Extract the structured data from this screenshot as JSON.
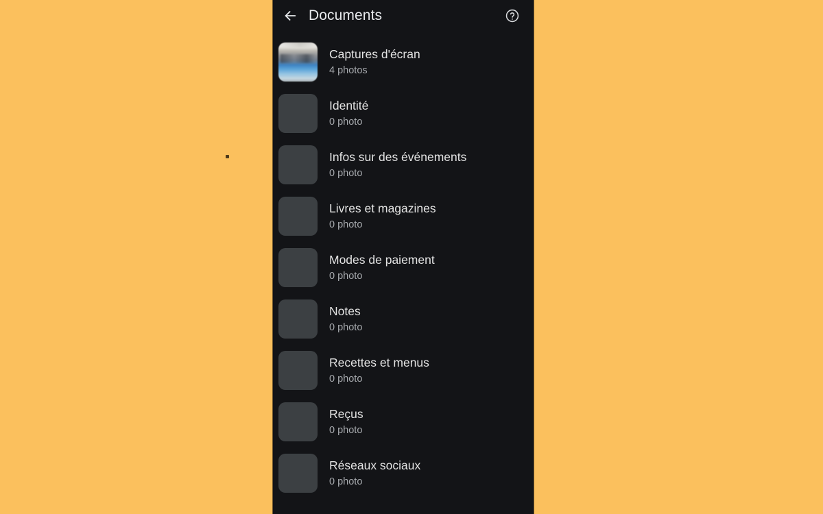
{
  "backdrop": {
    "color": "#fbc05d",
    "speck_color": "#3a2a12"
  },
  "phone": {
    "screen_bg": "#131417"
  },
  "app_bar": {
    "back_icon": "arrow-left-icon",
    "title": "Documents",
    "help_icon": "help-circle-icon",
    "title_color": "#e8eaed"
  },
  "list": {
    "items": [
      {
        "title": "Captures d'écran",
        "count": "4 photos",
        "thumb": "photo-thumbnail"
      },
      {
        "title": "Identité",
        "count": "0 photo",
        "thumb": "placeholder-thumbnail"
      },
      {
        "title": "Infos sur des événements",
        "count": "0 photo",
        "thumb": "placeholder-thumbnail"
      },
      {
        "title": "Livres et magazines",
        "count": "0 photo",
        "thumb": "placeholder-thumbnail"
      },
      {
        "title": "Modes de paiement",
        "count": "0 photo",
        "thumb": "placeholder-thumbnail"
      },
      {
        "title": "Notes",
        "count": "0 photo",
        "thumb": "placeholder-thumbnail"
      },
      {
        "title": "Recettes et menus",
        "count": "0 photo",
        "thumb": "placeholder-thumbnail"
      },
      {
        "title": "Reçus",
        "count": "0 photo",
        "thumb": "placeholder-thumbnail"
      },
      {
        "title": "Réseaux sociaux",
        "count": "0 photo",
        "thumb": "placeholder-thumbnail"
      }
    ],
    "title_color": "#e3e3e3",
    "subtitle_color": "#a8abaf",
    "placeholder_color": "#3c4043"
  }
}
